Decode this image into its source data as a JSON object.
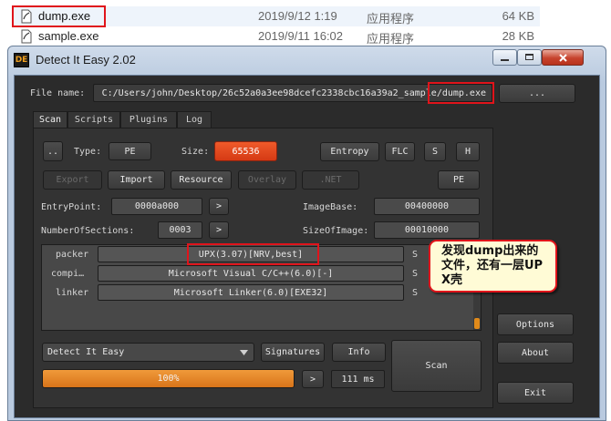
{
  "explorer": {
    "files": [
      {
        "name": "dump.exe",
        "date": "2019/9/12 1:19",
        "type": "应用程序",
        "size": "64 KB"
      },
      {
        "name": "sample.exe",
        "date": "2019/9/11 16:02",
        "type": "应用程序",
        "size": "28 KB"
      }
    ]
  },
  "window": {
    "title": "Detect It Easy 2.02",
    "icon_text": "DE"
  },
  "file": {
    "label": "File name:",
    "path": "C:/Users/john/Desktop/26c52a0a3ee98dcefc2338cbc16a39a2_sample/dump.exe",
    "browse_label": "..."
  },
  "tabs": [
    "Scan",
    "Scripts",
    "Plugins",
    "Log"
  ],
  "scan": {
    "dotdot_label": "..",
    "type_label": "Type:",
    "type_value": "PE",
    "size_label": "Size:",
    "size_value": "65536",
    "entropy_label": "Entropy",
    "flc_label": "FLC",
    "s_label": "S",
    "h_label": "H",
    "export_label": "Export",
    "import_label": "Import",
    "resource_label": "Resource",
    "overlay_label": "Overlay",
    "net_label": ".NET",
    "pe_label": "PE",
    "entrypoint_label": "EntryPoint:",
    "entrypoint_value": "0000a000",
    "imagebase_label": "ImageBase:",
    "imagebase_value": "00400000",
    "sections_label": "NumberOfSections:",
    "sections_value": "0003",
    "sizeofimage_label": "SizeOfImage:",
    "sizeofimage_value": "00010000",
    "arrow_label": ">",
    "results": [
      {
        "type": "packer",
        "value": "UPX(3.07)[NRV,best]",
        "flag": "S"
      },
      {
        "type": "compi…",
        "value": "Microsoft Visual C/C++(6.0)[-]",
        "flag": "S"
      },
      {
        "type": "linker",
        "value": "Microsoft Linker(6.0)[EXE32]",
        "flag": "S"
      }
    ],
    "callout_text": "发现dump出来的文件，还有一层UPX壳",
    "database_value": "Detect It Easy",
    "signatures_label": "Signatures",
    "info_label": "Info",
    "scan_label": "Scan",
    "progress": 100,
    "progress_text": "100%",
    "time_text": "111 ms"
  },
  "side": {
    "options_label": "Options",
    "about_label": "About",
    "exit_label": "Exit"
  },
  "colors": {
    "accent_orange": "#e07a1a",
    "size_red": "#e0401e",
    "highlight_red": "#e0141b",
    "callout_bg": "#fffbd6"
  }
}
